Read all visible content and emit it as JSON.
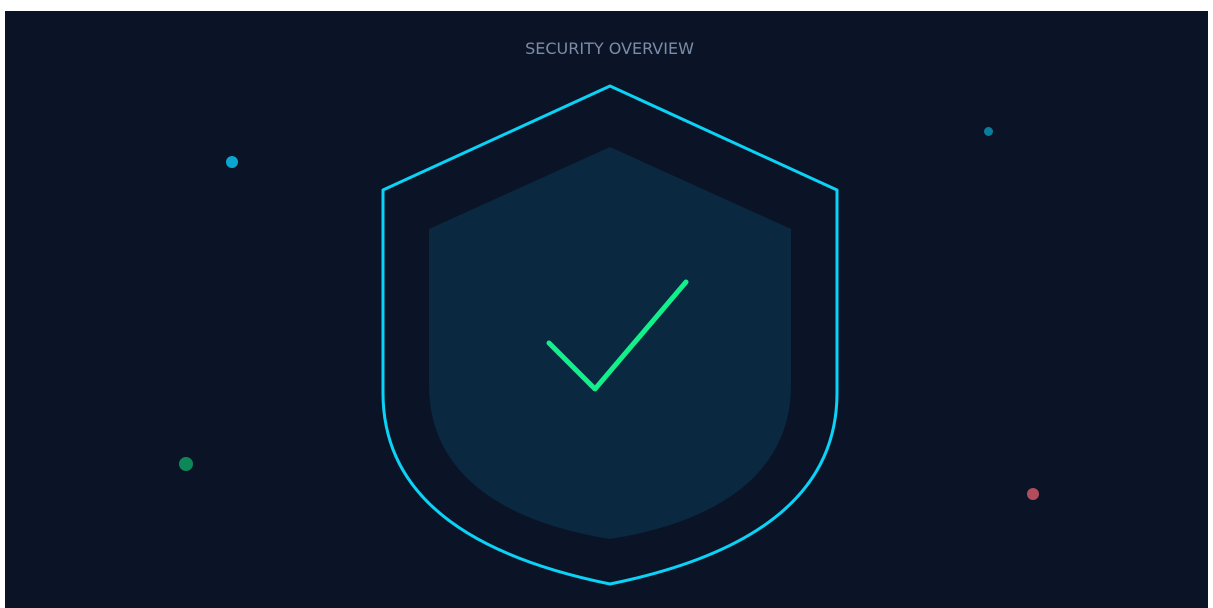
{
  "header": {
    "title": "SECURITY OVERVIEW"
  },
  "colors": {
    "background": "#0b1426",
    "title": "#7c8ba7",
    "shield_outline": "#0bd2f6",
    "shield_fill": "#0a2840",
    "check": "#12f08c",
    "particle_blue": "#0aa6cf",
    "particle_teal": "#0a7d9c",
    "particle_green": "#0d8757",
    "particle_red": "#b24d5b"
  },
  "icons": {
    "main": "shield-check-icon"
  },
  "particles": [
    {
      "name": "particle-blue",
      "color_key": "particle_blue"
    },
    {
      "name": "particle-teal",
      "color_key": "particle_teal"
    },
    {
      "name": "particle-green",
      "color_key": "particle_green"
    },
    {
      "name": "particle-red",
      "color_key": "particle_red"
    }
  ]
}
